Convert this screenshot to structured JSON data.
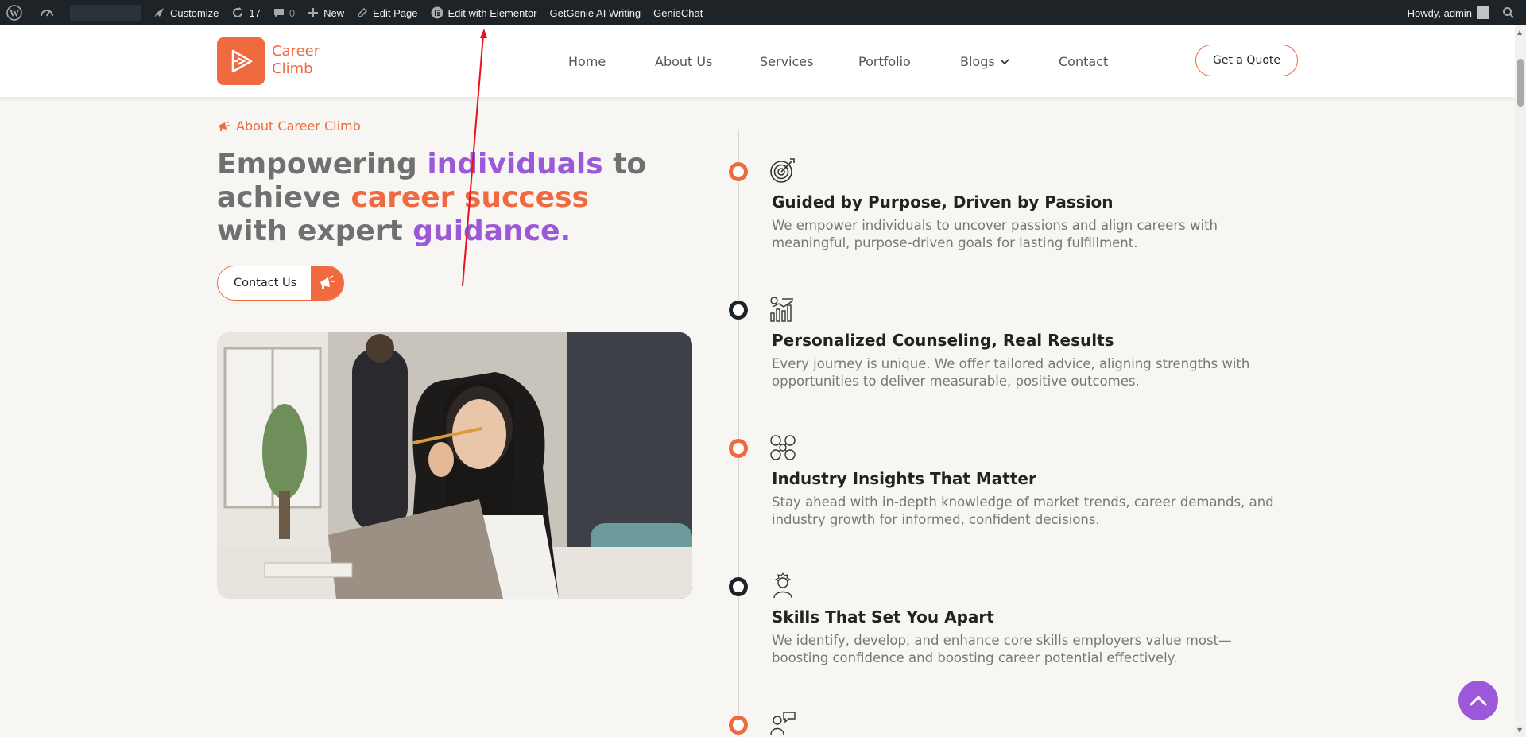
{
  "adminbar": {
    "customize": "Customize",
    "updates": "17",
    "comments": "0",
    "new": "New",
    "edit_page": "Edit Page",
    "edit_elementor": "Edit with Elementor",
    "getgenie": "GetGenie AI Writing",
    "geniechat": "GenieChat",
    "howdy": "Howdy, admin"
  },
  "header": {
    "logo_line1": "Career",
    "logo_line2": "Climb",
    "nav": [
      "Home",
      "About Us",
      "Services",
      "Portfolio",
      "Blogs",
      "Contact"
    ],
    "quote_button": "Get a Quote"
  },
  "hero": {
    "eyebrow": "About Career Climb",
    "headline_parts": {
      "p1": "Empowering ",
      "p2": "individuals",
      "p3": " to achieve ",
      "p4": "career success",
      "p5": " with expert ",
      "p6": "guidance."
    },
    "contact_button": "Contact Us"
  },
  "timeline": [
    {
      "title": "Guided by Purpose, Driven by Passion",
      "desc": "We empower individuals to uncover passions and align careers with meaningful, purpose-driven goals for lasting fulfillment.",
      "icon": "target-icon",
      "dot": "#ef6a3e"
    },
    {
      "title": "Personalized Counseling, Real Results",
      "desc": "Every journey is unique. We offer tailored advice, aligning strengths with opportunities to deliver measurable, positive outcomes.",
      "icon": "growth-chart-icon",
      "dot": "#1d2327"
    },
    {
      "title": "Industry Insights That Matter",
      "desc": "Stay ahead with in-depth knowledge of market trends, career demands, and industry growth for informed, confident decisions.",
      "icon": "network-icon",
      "dot": "#ef6a3e"
    },
    {
      "title": "Skills That Set You Apart",
      "desc": "We identify, develop, and enhance core skills employers value most—boosting confidence and boosting career potential effectively.",
      "icon": "skills-person-icon",
      "dot": "#1d2327"
    }
  ],
  "colors": {
    "accent": "#ef6a3e",
    "purple": "#9b59d9",
    "dark": "#1d2327"
  }
}
